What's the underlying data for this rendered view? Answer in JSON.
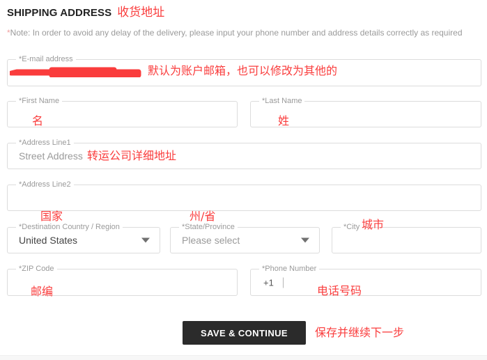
{
  "header": {
    "title": "SHIPPING ADDRESS",
    "title_annotation": "收货地址",
    "note_star": "*",
    "note": "Note: In order to avoid any delay of the delivery, please input your phone number and address details correctly as required"
  },
  "colors": {
    "annotation_red": "#fa3c3c",
    "button_bg": "#2b2b2b",
    "field_border": "#dcdcdc",
    "label_gray": "#9a9a9a"
  },
  "form": {
    "email": {
      "label": "*E-mail address",
      "value": "",
      "redacted": true,
      "annotation": "默认为账户邮箱，也可以修改为其他的"
    },
    "first_name": {
      "label": "*First Name",
      "value": "",
      "annotation": "名"
    },
    "last_name": {
      "label": "*Last Name",
      "value": "",
      "annotation": "姓"
    },
    "address_line1": {
      "label": "*Address Line1",
      "placeholder": "Street Address",
      "value": "",
      "annotation": "转运公司详细地址"
    },
    "address_line2": {
      "label": "*Address Line2",
      "value": "",
      "annotation": ""
    },
    "country": {
      "label": "*Destination Country / Region",
      "value": "United States",
      "annotation": "国家",
      "icon": "chevron-down-icon"
    },
    "state": {
      "label": "*State/Province",
      "value": "Please select",
      "is_placeholder": true,
      "annotation": "州/省",
      "icon": "chevron-down-icon"
    },
    "city": {
      "label": "*City",
      "value": "",
      "annotation": "城市"
    },
    "zip": {
      "label": "*ZIP Code",
      "value": "",
      "annotation": "邮编"
    },
    "phone": {
      "label": "*Phone Number",
      "prefix": "+1",
      "value": "",
      "annotation": "电话号码"
    }
  },
  "actions": {
    "save_label": "SAVE & CONTINUE",
    "save_annotation": "保存并继续下一步"
  }
}
